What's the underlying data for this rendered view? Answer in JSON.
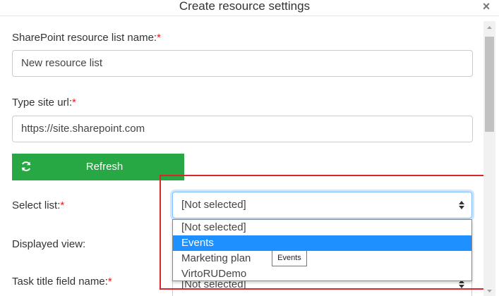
{
  "dialog": {
    "title": "Create resource settings",
    "close_glyph": "×"
  },
  "form": {
    "list_name_label": "SharePoint resource list name:",
    "list_name_value": "New resource list",
    "site_url_label": "Type site url:",
    "site_url_value": "https://site.sharepoint.com",
    "refresh_label": "Refresh",
    "select_list_label": "Select list:",
    "select_list_value": "[Not selected]",
    "displayed_view_label": "Displayed view:",
    "task_title_label": "Task title field name:",
    "task_title_value": "[Not selected]",
    "required_mark": "*"
  },
  "dropdown": {
    "options": [
      "[Not selected]",
      "Events",
      "Marketing plan",
      "VirtoRUDemo"
    ],
    "highlighted": "Events"
  },
  "tooltip": {
    "text": "Events"
  },
  "colors": {
    "accent_button": "#28a745",
    "highlight": "#1e90ff",
    "required": "#e41b1b",
    "annotation_box": "#d9262c"
  },
  "icons": {
    "refresh": "refresh-icon",
    "caret": "sort-caret-icon",
    "close": "close-icon"
  }
}
